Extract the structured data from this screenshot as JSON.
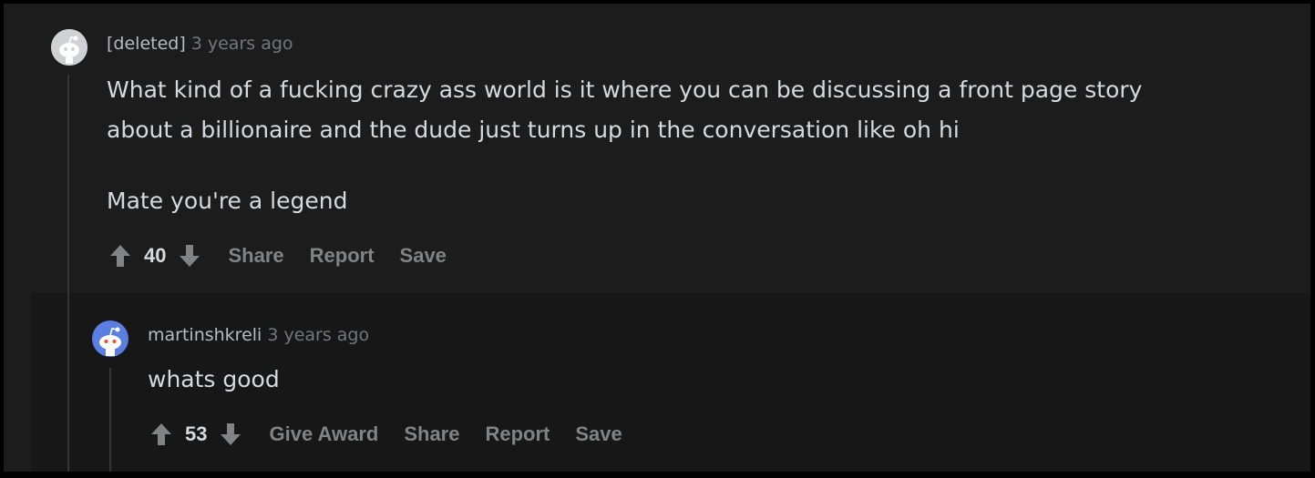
{
  "comments": [
    {
      "username": "[deleted]",
      "time": "3 years ago",
      "paragraphs": [
        "What kind of a fucking crazy ass world is it where you can be discussing a front page story",
        "about a billionaire and the dude just turns up in the conversation like oh hi",
        "Mate you're a legend"
      ],
      "votes": "40",
      "actions": [
        "Share",
        "Report",
        "Save"
      ]
    },
    {
      "username": "martinshkreli",
      "time": "3 years ago",
      "paragraphs": [
        "whats good"
      ],
      "votes": "53",
      "actions": [
        "Give Award",
        "Share",
        "Report",
        "Save"
      ]
    }
  ],
  "colors": {
    "background": "#1c1c1d",
    "reply_background": "#171718",
    "text": "#d7dadc",
    "meta": "#74777a",
    "action": "#818384",
    "avatar_deleted": "#cfd2d4",
    "avatar_user": "#5b7fe0"
  },
  "icons": [
    "avatar-deleted-icon",
    "snoo-avatar-icon",
    "upvote-icon",
    "downvote-icon"
  ]
}
